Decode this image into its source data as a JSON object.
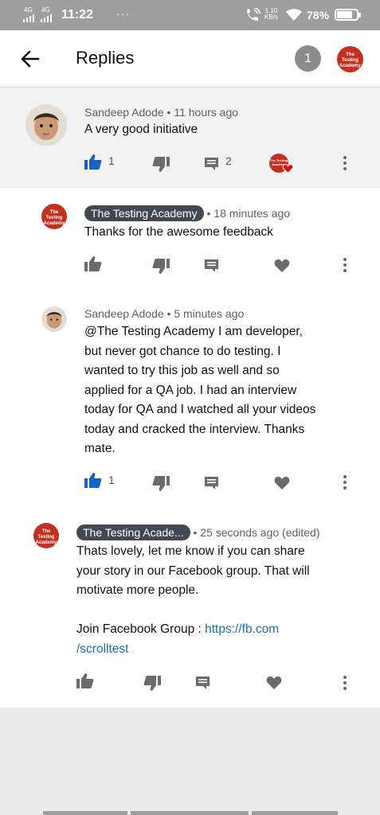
{
  "status_bar": {
    "signal1": "4G",
    "signal2": "4G",
    "time": "11:22",
    "menu_dots": "···",
    "net_speed_value": "1.10",
    "net_speed_unit": "KB/s",
    "battery_percent": "78%",
    "battery_level": 0.78
  },
  "appbar": {
    "title": "Replies",
    "count_badge": "1"
  },
  "channel": {
    "logo_line1": "The Testing",
    "logo_line2": "Academy"
  },
  "comments": [
    {
      "author": "Sandeep Adode",
      "time": "11 hours ago",
      "text": "A very good initiative",
      "likes": "1",
      "replies": "2",
      "liked": true
    },
    {
      "author": "The Testing Academy",
      "time": "18 minutes ago",
      "text": "Thanks for the awesome feedback"
    },
    {
      "author": "Sandeep Adode",
      "time": "5 minutes ago",
      "text_lines": [
        "@The Testing Academy  I am  developer,",
        "but never got chance to do testing. I",
        "wanted to try this job as well and so",
        "applied for a QA job. I had an interview",
        "today for QA and I watched all your videos",
        "today and cracked the interview. Thanks",
        "mate."
      ],
      "likes": "1",
      "liked": true
    },
    {
      "author": "The Testing Acade...",
      "time": "25 seconds ago (edited)",
      "text_lines": [
        "Thats lovely, let me know if you can share",
        "your story in our Facebook group. That will",
        "motivate more people."
      ],
      "link_prefix": "Join Facebook Group : ",
      "link_part1": "https://fb.com",
      "link_part2": "/scrolltest"
    }
  ],
  "colors": {
    "accent_blue": "#1565c0",
    "brand_red": "#c4301f",
    "chip_bg": "#3f4a55",
    "link": "#1a6fb3"
  }
}
